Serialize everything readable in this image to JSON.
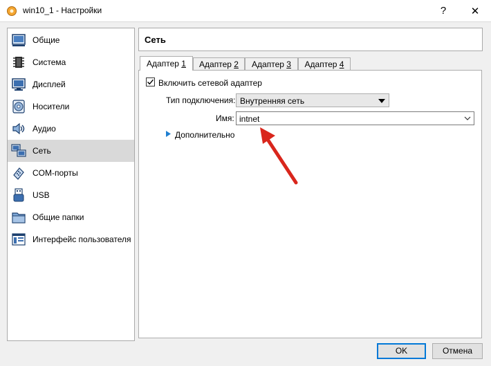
{
  "window": {
    "title": "win10_1 - Настройки",
    "help_label": "?",
    "close_label": "✕"
  },
  "sidebar": {
    "items": [
      {
        "label": "Общие",
        "icon": "general-icon"
      },
      {
        "label": "Система",
        "icon": "system-chip-icon"
      },
      {
        "label": "Дисплей",
        "icon": "display-monitor-icon"
      },
      {
        "label": "Носители",
        "icon": "storage-disc-icon"
      },
      {
        "label": "Аудио",
        "icon": "audio-speaker-icon"
      },
      {
        "label": "Сеть",
        "icon": "network-icon",
        "selected": true
      },
      {
        "label": "COM-порты",
        "icon": "serial-port-icon"
      },
      {
        "label": "USB",
        "icon": "usb-icon"
      },
      {
        "label": "Общие папки",
        "icon": "shared-folder-icon"
      },
      {
        "label": "Интерфейс пользователя",
        "icon": "user-interface-icon"
      }
    ]
  },
  "header": {
    "title": "Сеть"
  },
  "tabs": [
    {
      "label": "Адаптер ",
      "num": "1",
      "active": true
    },
    {
      "label": "Адаптер ",
      "num": "2"
    },
    {
      "label": "Адаптер ",
      "num": "3"
    },
    {
      "label": "Адаптер ",
      "num": "4"
    }
  ],
  "adapter": {
    "enable_label": "Включить сетевой адаптер",
    "enabled": true,
    "attachment_label": "Тип подключения:",
    "attachment_value": "Внутренняя сеть",
    "name_label": "Имя:",
    "name_value": "intnet",
    "advanced_label": "Дополнительно"
  },
  "annotation": {
    "arrow_color": "#d9261c"
  },
  "buttons": {
    "ok_label": "OK",
    "cancel_label": "Отмена"
  },
  "colors": {
    "accent": "#0078d7",
    "selected_item": "#d9d9d9"
  }
}
